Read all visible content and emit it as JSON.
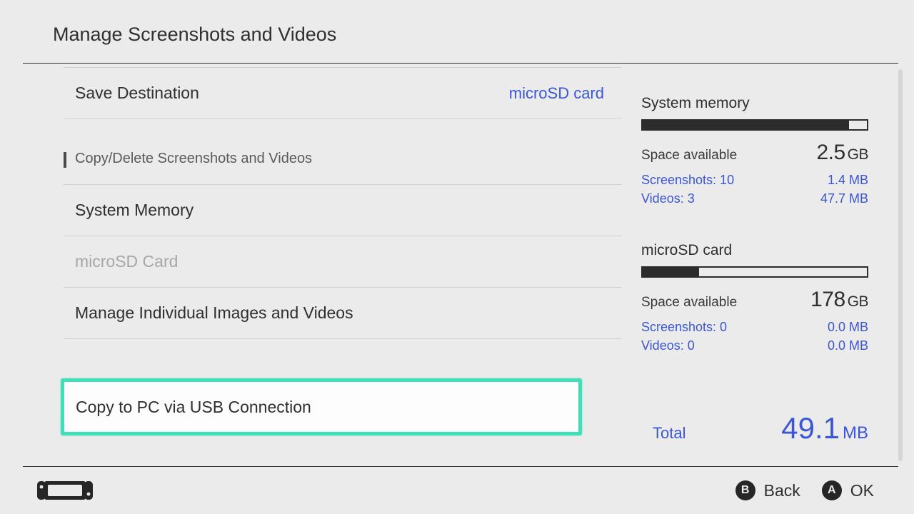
{
  "header": {
    "title": "Manage Screenshots and Videos"
  },
  "menu": {
    "save_dest": {
      "label": "Save Destination",
      "value": "microSD card"
    },
    "section_label": "Copy/Delete Screenshots and Videos",
    "system_memory": "System Memory",
    "microsd_card": "microSD Card",
    "manage_individual": "Manage Individual Images and Videos",
    "copy_usb": "Copy to PC via USB Connection"
  },
  "storage": {
    "system": {
      "title": "System memory",
      "fill_percent": 92,
      "space_label": "Space available",
      "space_value": "2.5",
      "space_unit": "GB",
      "screens_label": "Screenshots: 10",
      "screens_value": "1.4 MB",
      "videos_label": "Videos: 3",
      "videos_value": "47.7 MB"
    },
    "sd": {
      "title": "microSD card",
      "fill_percent": 25,
      "space_label": "Space available",
      "space_value": "178",
      "space_unit": "GB",
      "screens_label": "Screenshots: 0",
      "screens_value": "0.0 MB",
      "videos_label": "Videos: 0",
      "videos_value": "0.0 MB"
    },
    "total": {
      "label": "Total",
      "value": "49.1",
      "unit": "MB"
    }
  },
  "footer": {
    "back": {
      "button": "B",
      "label": "Back"
    },
    "ok": {
      "button": "A",
      "label": "OK"
    }
  }
}
